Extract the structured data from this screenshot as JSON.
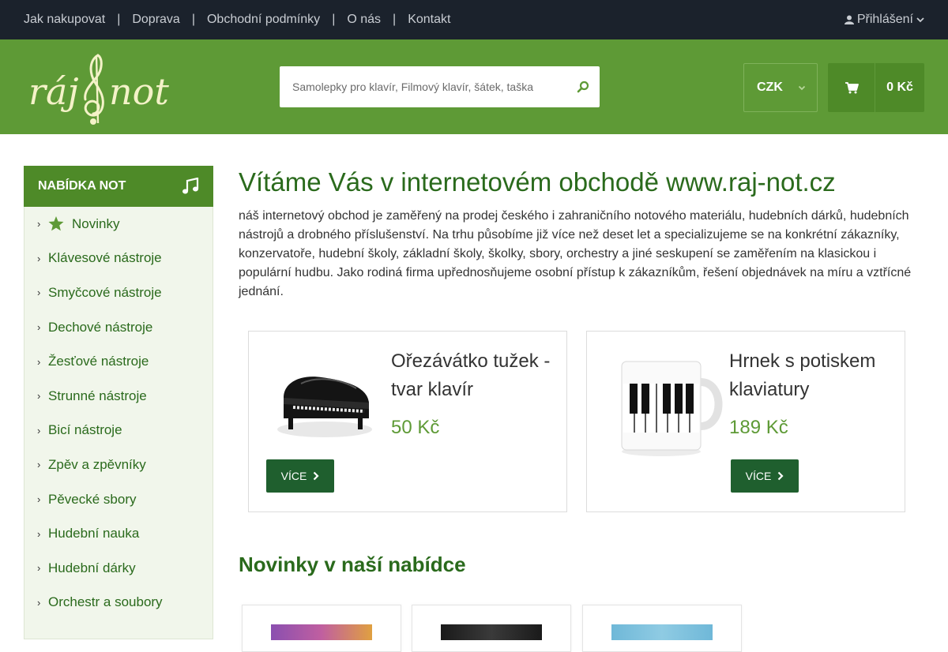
{
  "topbar": {
    "nav": [
      "Jak nakupovat",
      "Doprava",
      "Obchodní podmínky",
      "O nás",
      "Kontakt"
    ],
    "separator": "|",
    "login_label": "Přihlášení"
  },
  "header": {
    "logo_text": "ráj not",
    "search_placeholder": "Samolepky pro klavír, Filmový klavír, šátek, taška",
    "currency": "CZK",
    "cart_total": "0 Kč"
  },
  "sidebar": {
    "title": "NABÍDKA NOT",
    "items": [
      "Novinky",
      "Klávesové nástroje",
      "Smyčcové nástroje",
      "Dechové nástroje",
      "Žesťové nástroje",
      "Strunné nástroje",
      "Bicí nástroje",
      "Zpěv a zpěvníky",
      "Pěvecké sbory",
      "Hudební nauka",
      "Hudební dárky",
      "Orchestr a soubory"
    ]
  },
  "main": {
    "title": "Vítáme Vás v internetovém obchodě www.raj-not.cz",
    "intro": "náš internetový obchod je zaměřený na prodej českého i zahraničního notového materiálu, hudebních dárků, hudebních nástrojů a drobného příslušenství. Na trhu působíme již více než deset let a specializujeme se na konkrétní zákazníky, konzervatoře, hudební školy, základní školy, školky, sbory, orchestry a jiné seskupení se zaměřením na klasickou i populární hudbu. Jako rodiná firma upřednosňujeme osobní přístup k zákazníkům, řešení objednávek na míru a vztřícné jednání.",
    "products": [
      {
        "name": "Ořezávátko tužek - tvar klavír",
        "price": "50 Kč",
        "button": "VÍCE"
      },
      {
        "name": "Hrnek s potiskem klaviatury",
        "price": "189 Kč",
        "button": "VÍCE"
      }
    ],
    "new_title": "Novinky v naší nabídce"
  },
  "colors": {
    "topbar": "#1b222c",
    "header_green": "#5e9a36",
    "dark_green": "#1f5f2e",
    "title_green": "#2a6a1c"
  }
}
